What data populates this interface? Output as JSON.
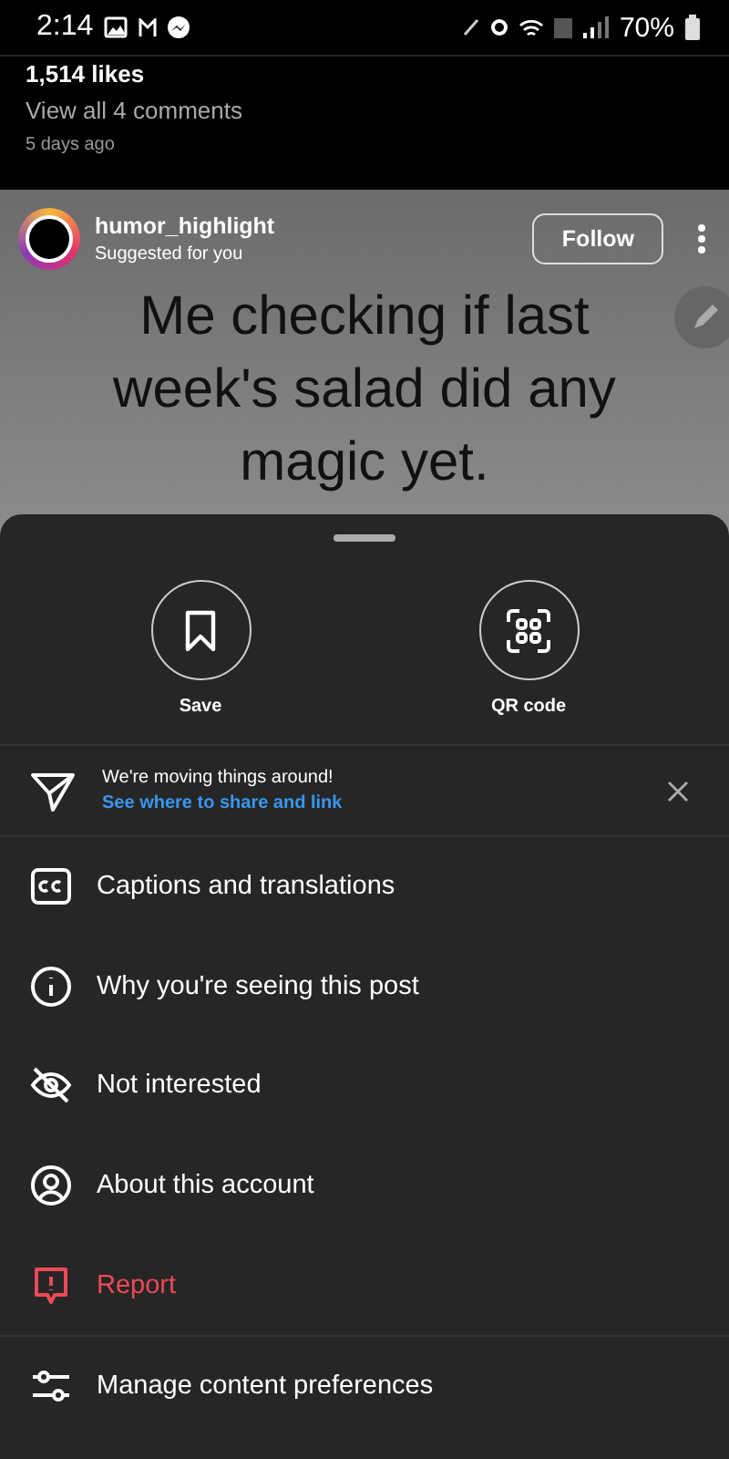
{
  "status_bar": {
    "time": "2:14",
    "battery": "70%"
  },
  "post_meta": {
    "likes": "1,514 likes",
    "comments": "View all 4 comments",
    "age": "5 days ago"
  },
  "post": {
    "username": "humor_highlight",
    "subtitle": "Suggested for you",
    "follow": "Follow",
    "caption": "Me checking if last week's salad did any magic yet."
  },
  "sheet": {
    "actions": [
      {
        "kind": "save",
        "label": "Save"
      },
      {
        "kind": "qr",
        "label": "QR code"
      }
    ],
    "notice": {
      "text": "We're moving things around!",
      "link": "See where to share and link"
    },
    "items": [
      {
        "kind": "captions",
        "label": "Captions and translations",
        "danger": false
      },
      {
        "kind": "info",
        "label": "Why you're seeing this post",
        "danger": false
      },
      {
        "kind": "hidden",
        "label": "Not interested",
        "danger": false
      },
      {
        "kind": "account",
        "label": "About this account",
        "danger": false
      },
      {
        "kind": "report",
        "label": "Report",
        "danger": true
      },
      {
        "kind": "sliders",
        "label": "Manage content preferences",
        "danger": false
      }
    ]
  }
}
